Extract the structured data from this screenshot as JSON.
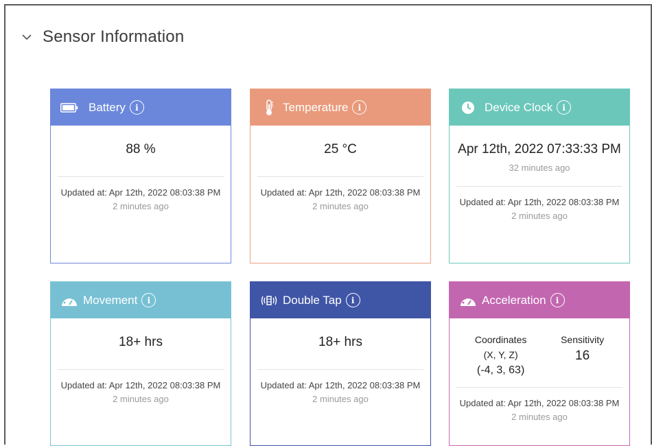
{
  "section": {
    "title": "Sensor Information"
  },
  "cards": {
    "battery": {
      "title": "Battery",
      "value": "88 %",
      "updated": "Updated at: Apr 12th, 2022 08:03:38 PM",
      "ago": "2 minutes ago"
    },
    "temperature": {
      "title": "Temperature",
      "value": "25 °C",
      "updated": "Updated at: Apr 12th, 2022 08:03:38 PM",
      "ago": "2 minutes ago"
    },
    "clock": {
      "title": "Device Clock",
      "value": "Apr 12th, 2022 07:33:33 PM",
      "value_ago": "32 minutes ago",
      "updated": "Updated at: Apr 12th, 2022 08:03:38 PM",
      "ago": "2 minutes ago"
    },
    "movement": {
      "title": "Movement",
      "value": "18+ hrs",
      "updated": "Updated at: Apr 12th, 2022 08:03:38 PM",
      "ago": "2 minutes ago"
    },
    "doubletap": {
      "title": "Double Tap",
      "value": "18+ hrs",
      "updated": "Updated at: Apr 12th, 2022 08:03:38 PM",
      "ago": "2 minutes ago"
    },
    "acceleration": {
      "title": "Acceleration",
      "coord_label": "Coordinates",
      "coord_axes": "(X, Y, Z)",
      "coord_value": "(-4, 3, 63)",
      "sens_label": "Sensitivity",
      "sens_value": "16",
      "updated": "Updated at: Apr 12th, 2022 08:03:38 PM",
      "ago": "2 minutes ago"
    }
  },
  "colors": {
    "battery": "#6a87db",
    "temperature": "#e99a7c",
    "clock": "#6cc7bb",
    "movement": "#77c0d4",
    "doubletap": "#3f55a6",
    "acceleration": "#c366b0"
  },
  "icons": {
    "section_toggle": "chevron-down-icon",
    "battery": "battery-icon",
    "temperature": "thermometer-icon",
    "clock": "clock-icon",
    "movement": "speedometer-icon",
    "doubletap": "vibration-icon",
    "acceleration": "speedometer-icon",
    "info": "info-icon"
  }
}
